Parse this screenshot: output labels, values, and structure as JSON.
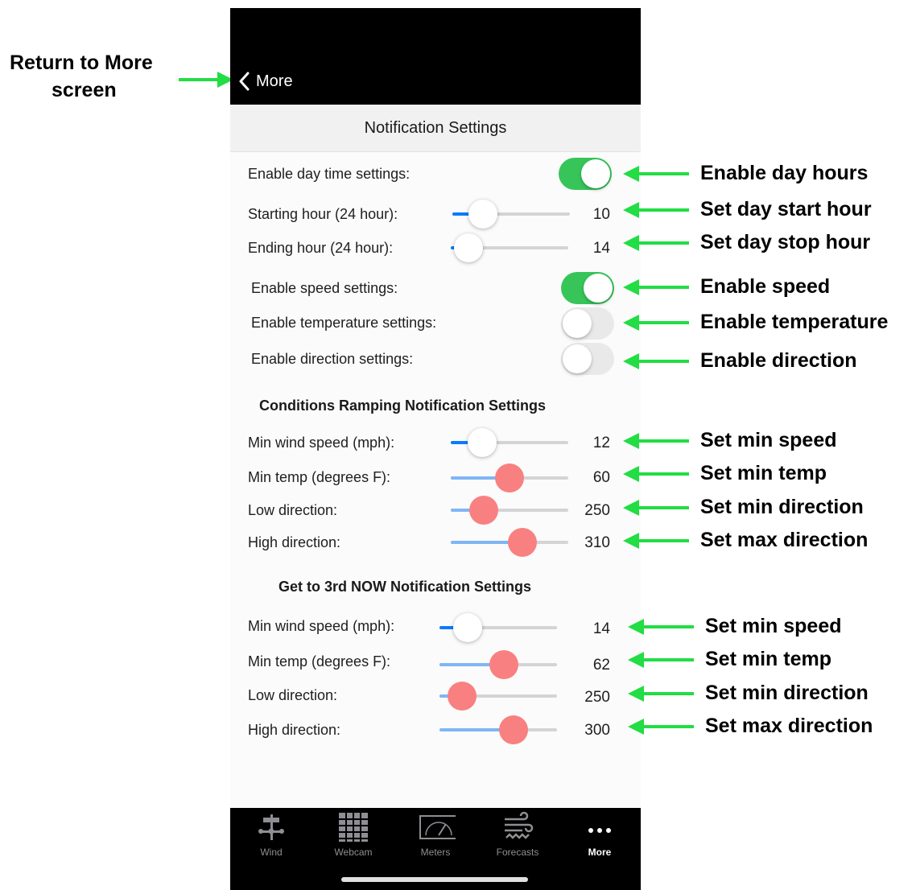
{
  "annotations": {
    "return_label": [
      "Return to More",
      "screen"
    ],
    "items": [
      "Enable day hours",
      "Set day start hour",
      "Set day stop hour",
      "Enable speed",
      "Enable temperature",
      "Enable direction",
      "Set min speed",
      "Set min temp",
      "Set min direction",
      "Set max direction",
      "Set min speed",
      "Set min temp",
      "Set min direction",
      "Set max direction"
    ],
    "arrow_color": "#22dd44"
  },
  "nav": {
    "back_label": "More",
    "title": "Notification Settings"
  },
  "toggles": [
    {
      "label": "Enable day time settings:",
      "on": true
    },
    {
      "label": "Enable speed settings:",
      "on": true
    },
    {
      "label": "Enable temperature settings:",
      "on": false
    },
    {
      "label": "Enable direction settings:",
      "on": false
    }
  ],
  "day_hours": [
    {
      "label": "Starting hour (24 hour):",
      "value": "10",
      "fill": 0.26
    },
    {
      "label": "Ending hour (24 hour):",
      "value": "14",
      "fill": 0.15
    }
  ],
  "ramping": {
    "title": "Conditions Ramping Notification Settings",
    "sliders": [
      {
        "label": "Min wind speed (mph):",
        "value": "12",
        "fill": 0.27
      },
      {
        "label": "Min temp (degrees F):",
        "value": "60",
        "fill": 0.5
      },
      {
        "label": "Low direction:",
        "value": "250",
        "fill": 0.28
      },
      {
        "label": "High direction:",
        "value": "310",
        "fill": 0.61
      }
    ]
  },
  "third_now": {
    "title": "Get to 3rd NOW Notification Settings",
    "sliders": [
      {
        "label": "Min wind speed (mph):",
        "value": "14",
        "fill": 0.24
      },
      {
        "label": "Min temp (degrees F):",
        "value": "62",
        "fill": 0.55
      },
      {
        "label": "Low direction:",
        "value": "250",
        "fill": 0.19
      },
      {
        "label": "High direction:",
        "value": "300",
        "fill": 0.63
      }
    ]
  },
  "tabs": [
    {
      "label": "Wind",
      "icon": "weathervane-icon",
      "active": false
    },
    {
      "label": "Webcam",
      "icon": "webcam-grid-icon",
      "active": false
    },
    {
      "label": "Meters",
      "icon": "gauge-meter-icon",
      "active": false
    },
    {
      "label": "Forecasts",
      "icon": "wind-waves-icon",
      "active": false
    },
    {
      "label": "More",
      "icon": "ellipsis-icon",
      "active": true
    }
  ],
  "colors": {
    "toggle_on": "#37c55a",
    "slider_fill": "#0a7aff",
    "slider_thumb_red": "#f98080",
    "slider_fill_light": "#7fb6f5"
  }
}
